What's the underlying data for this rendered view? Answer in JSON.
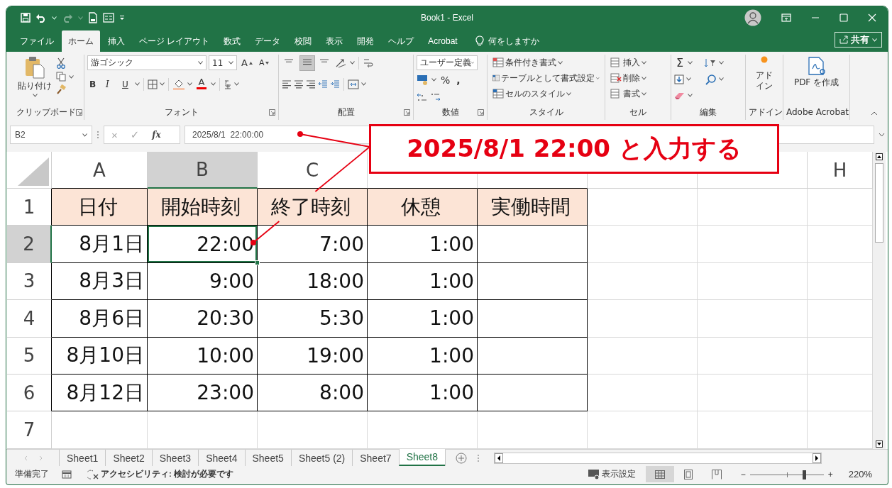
{
  "window": {
    "title": "Book1 - Excel"
  },
  "menu_tabs": [
    {
      "label": "ファイル",
      "selected": false
    },
    {
      "label": "ホーム",
      "selected": true
    },
    {
      "label": "挿入",
      "selected": false
    },
    {
      "label": "ページ レイアウト",
      "selected": false
    },
    {
      "label": "数式",
      "selected": false
    },
    {
      "label": "データ",
      "selected": false
    },
    {
      "label": "校閲",
      "selected": false
    },
    {
      "label": "表示",
      "selected": false
    },
    {
      "label": "開発",
      "selected": false
    },
    {
      "label": "ヘルプ",
      "selected": false
    },
    {
      "label": "Acrobat",
      "selected": false
    }
  ],
  "tell_me": "何をしますか",
  "share_button": "共有",
  "ribbon": {
    "clipboard": {
      "paste": "貼り付け",
      "label": "クリップボード"
    },
    "font": {
      "name": "游ゴシック",
      "size": "11",
      "grow": "A",
      "shrink": "A",
      "bold": "B",
      "italic": "I",
      "underline": "U",
      "color_button": "A",
      "label": "フォント"
    },
    "alignment": {
      "vertical": [
        {
          "selected": false
        },
        {
          "selected": true
        },
        {
          "selected": false
        }
      ],
      "label": "配置"
    },
    "number": {
      "format": "ユーザー定義",
      "percent": "%",
      "comma": ",",
      "label": "数値"
    },
    "styles": {
      "items": [
        "条件付き書式",
        "テーブルとして書式設定",
        "セルのスタイル"
      ],
      "label": "スタイル"
    },
    "cells": {
      "items": [
        "挿入",
        "削除",
        "書式"
      ],
      "label": "セル"
    },
    "editing": {
      "sum": "Σ",
      "label": "編集"
    },
    "addins": {
      "button": "アドイン",
      "label": "アドイン"
    },
    "acrobat": {
      "button": "PDF を作成",
      "label": "Adobe Acrobat"
    }
  },
  "formula_bar": {
    "name_box": "B2",
    "cancel": "×",
    "enter": "✓",
    "fx": "fx",
    "value": "2025/8/1  22:00:00"
  },
  "sheet": {
    "columns": [
      {
        "label": "A",
        "selected": false
      },
      {
        "label": "B",
        "selected": true
      },
      {
        "label": "C",
        "selected": false
      },
      {
        "selected": false
      },
      {
        "selected": false
      },
      {
        "selected": false
      },
      {
        "selected": false
      },
      {
        "label": "H",
        "selected": false
      }
    ],
    "rows": [
      {
        "header": "1",
        "selected": false,
        "kind": "header",
        "cells": [
          "日付",
          "開始時刻",
          "終了時刻",
          "休憩",
          "実働時間"
        ]
      },
      {
        "header": "2",
        "selected": true,
        "kind": "data",
        "cells": [
          "8月1日",
          "22:00",
          "7:00",
          "1:00"
        ]
      },
      {
        "header": "3",
        "selected": false,
        "kind": "data",
        "cells": [
          "8月3日",
          "9:00",
          "18:00",
          "1:00"
        ]
      },
      {
        "header": "4",
        "selected": false,
        "kind": "data",
        "cells": [
          "8月6日",
          "20:30",
          "5:30",
          "1:00"
        ]
      },
      {
        "header": "5",
        "selected": false,
        "kind": "data",
        "cells": [
          "8月10日",
          "10:00",
          "19:00",
          "1:00"
        ]
      },
      {
        "header": "6",
        "selected": false,
        "kind": "data",
        "cells": [
          "8月12日",
          "23:00",
          "8:00",
          "1:00"
        ]
      },
      {
        "header": "7",
        "selected": false,
        "kind": "empty",
        "cells": []
      }
    ]
  },
  "sheet_tabs": [
    {
      "label": "Sheet1",
      "selected": false
    },
    {
      "label": "Sheet2",
      "selected": false
    },
    {
      "label": "Sheet3",
      "selected": false
    },
    {
      "label": "Sheet4",
      "selected": false
    },
    {
      "label": "Sheet5",
      "selected": false
    },
    {
      "label": "Sheet5 (2)",
      "selected": false
    },
    {
      "label": "Sheet7",
      "selected": false
    },
    {
      "label": "Sheet8",
      "selected": true
    }
  ],
  "status_bar": {
    "ready": "準備完了",
    "accessibility": "アクセシビリティ: 検討が必要です",
    "display_settings": "表示設定",
    "views": [
      {
        "selected": true
      },
      {
        "selected": false
      },
      {
        "selected": false
      }
    ],
    "zoom": {
      "minus": "−",
      "plus": "+",
      "level": 0.73,
      "reading": "220%"
    }
  },
  "callout": {
    "text": "2025/8/1 22:00 と入力する"
  }
}
